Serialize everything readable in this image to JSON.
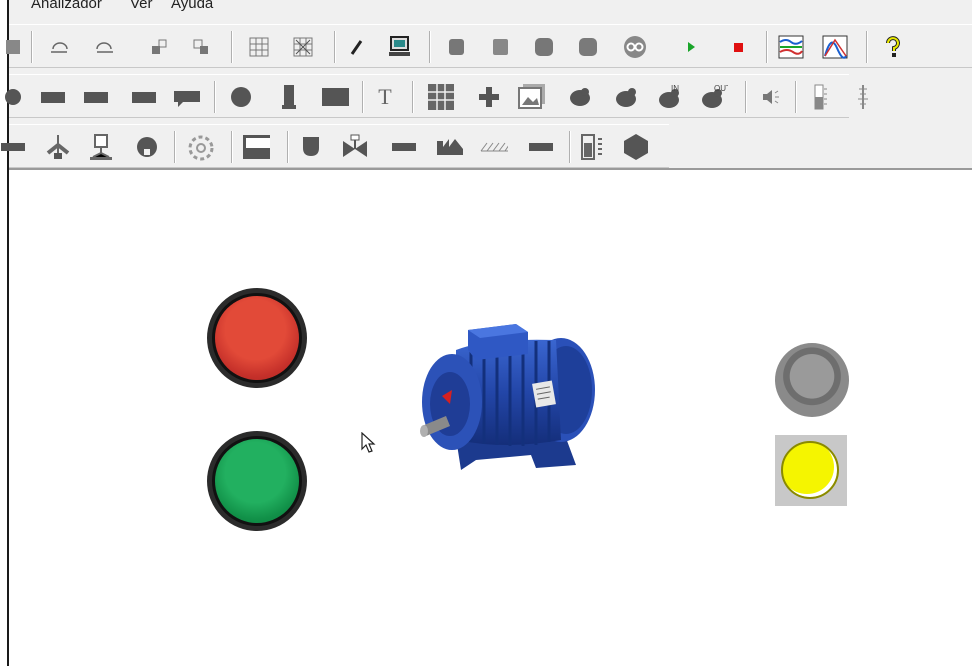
{
  "menu": {
    "items": [
      "Analizador",
      "Ver",
      "Ayuda"
    ]
  },
  "colors": {
    "stop_button": "#d6392b",
    "start_button": "#139a4f",
    "motor_blue": "#2346a8",
    "lamp_off": "#8a8a8a",
    "lamp_on": "#f5f500",
    "play_green": "#1aa52a",
    "stop_red": "#e01010"
  },
  "toolbar": {
    "row1": [
      "save-icon",
      "undo-icon",
      "redo-icon",
      "group-icon",
      "ungroup-icon",
      "grid-icon",
      "snap-grid-icon",
      "pencil-icon",
      "computer-icon",
      "layer-icon",
      "page-icon",
      "shape-icon",
      "shape-alt-icon",
      "link-icon",
      "play-icon",
      "stop-icon",
      "trend-chart-icon",
      "curve-chart-icon",
      "help-icon"
    ],
    "row2": [
      "circle-icon",
      "rect-icon",
      "rect-icon",
      "rect-icon",
      "flag-rect-icon",
      "circle-icon",
      "column-icon",
      "rect-icon",
      "text-icon",
      "table-icon",
      "cross-icon",
      "image-icon",
      "blob-icon",
      "blob-icon",
      "input-icon",
      "output-icon",
      "speaker-icon",
      "slider-v-icon",
      "slider-scale-icon"
    ],
    "text_tool_label": "T",
    "in_label": "IN",
    "out_label": "OUT",
    "row3": [
      "pipe-icon",
      "fan-icon",
      "tank-icon",
      "pump-icon",
      "gear-icon",
      "panel-icon",
      "valve-icon",
      "valve2-icon",
      "bar-icon",
      "conveyor-icon",
      "hatch-icon",
      "bar-icon",
      "scale-icon",
      "hexagon-icon"
    ]
  },
  "canvas": {
    "elements": [
      "stop-pushbutton",
      "start-pushbutton",
      "electric-motor",
      "status-lamp-off",
      "status-lamp-on"
    ]
  }
}
